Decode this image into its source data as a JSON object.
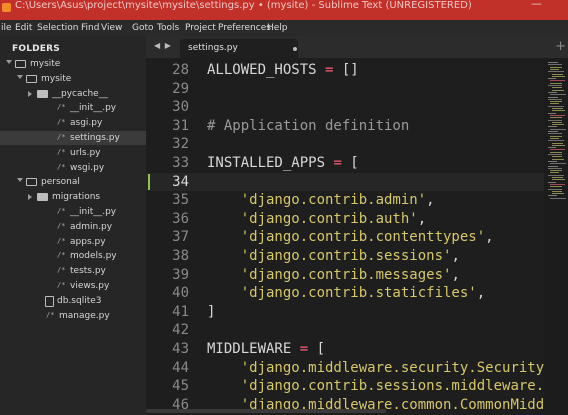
{
  "window": {
    "title": "C:\\Users\\Asus\\project\\mysite\\mysite\\settings.py • (mysite) - Sublime Text (UNREGISTERED)",
    "minimize_glyph": "—"
  },
  "menu": [
    "ile",
    "Edit",
    "Selection",
    "Find",
    "View",
    "Goto",
    "Tools",
    "Project",
    "Preferences",
    "Help"
  ],
  "sidebar": {
    "heading": "FOLDERS",
    "items": [
      {
        "label": "mysite",
        "kind": "folder-open"
      },
      {
        "label": "mysite",
        "kind": "folder-open"
      },
      {
        "label": "__pycache__",
        "kind": "folder-closed"
      },
      {
        "label": "__init__.py",
        "kind": "file"
      },
      {
        "label": "asgi.py",
        "kind": "file"
      },
      {
        "label": "settings.py",
        "kind": "file",
        "selected": true
      },
      {
        "label": "urls.py",
        "kind": "file"
      },
      {
        "label": "wsgi.py",
        "kind": "file"
      },
      {
        "label": "personal",
        "kind": "folder-open"
      },
      {
        "label": "migrations",
        "kind": "folder-closed"
      },
      {
        "label": "__init__.py",
        "kind": "file"
      },
      {
        "label": "admin.py",
        "kind": "file"
      },
      {
        "label": "apps.py",
        "kind": "file"
      },
      {
        "label": "models.py",
        "kind": "file"
      },
      {
        "label": "tests.py",
        "kind": "file"
      },
      {
        "label": "views.py",
        "kind": "file"
      },
      {
        "label": "db.sqlite3",
        "kind": "doc"
      },
      {
        "label": "manage.py",
        "kind": "file"
      }
    ],
    "file_glyph": "/*"
  },
  "tabbar": {
    "nav": "◀ ▶",
    "active_tab": "settings.py",
    "new_tab": "+"
  },
  "editor": {
    "active_line": 34,
    "lines": [
      {
        "n": 28,
        "tokens": [
          [
            "plain",
            "ALLOWED_HOSTS "
          ],
          [
            "op",
            "="
          ],
          [
            "plain",
            " []"
          ]
        ]
      },
      {
        "n": 29,
        "tokens": []
      },
      {
        "n": 30,
        "tokens": []
      },
      {
        "n": 31,
        "tokens": [
          [
            "comment",
            "# Application definition"
          ]
        ]
      },
      {
        "n": 32,
        "tokens": []
      },
      {
        "n": 33,
        "tokens": [
          [
            "plain",
            "INSTALLED_APPS "
          ],
          [
            "op",
            "="
          ],
          [
            "plain",
            " ["
          ]
        ]
      },
      {
        "n": 34,
        "tokens": []
      },
      {
        "n": 35,
        "tokens": [
          [
            "plain",
            "    "
          ],
          [
            "str",
            "'django.contrib.admin'"
          ],
          [
            "plain",
            ","
          ]
        ]
      },
      {
        "n": 36,
        "tokens": [
          [
            "plain",
            "    "
          ],
          [
            "str",
            "'django.contrib.auth'"
          ],
          [
            "plain",
            ","
          ]
        ]
      },
      {
        "n": 37,
        "tokens": [
          [
            "plain",
            "    "
          ],
          [
            "str",
            "'django.contrib.contenttypes'"
          ],
          [
            "plain",
            ","
          ]
        ]
      },
      {
        "n": 38,
        "tokens": [
          [
            "plain",
            "    "
          ],
          [
            "str",
            "'django.contrib.sessions'"
          ],
          [
            "plain",
            ","
          ]
        ]
      },
      {
        "n": 39,
        "tokens": [
          [
            "plain",
            "    "
          ],
          [
            "str",
            "'django.contrib.messages'"
          ],
          [
            "plain",
            ","
          ]
        ]
      },
      {
        "n": 40,
        "tokens": [
          [
            "plain",
            "    "
          ],
          [
            "str",
            "'django.contrib.staticfiles'"
          ],
          [
            "plain",
            ","
          ]
        ]
      },
      {
        "n": 41,
        "tokens": [
          [
            "plain",
            "]"
          ]
        ]
      },
      {
        "n": 42,
        "tokens": []
      },
      {
        "n": 43,
        "tokens": [
          [
            "plain",
            "MIDDLEWARE "
          ],
          [
            "op",
            "="
          ],
          [
            "plain",
            " ["
          ]
        ]
      },
      {
        "n": 44,
        "tokens": [
          [
            "plain",
            "    "
          ],
          [
            "str",
            "'django.middleware.security.Security"
          ]
        ]
      },
      {
        "n": 45,
        "tokens": [
          [
            "plain",
            "    "
          ],
          [
            "str",
            "'django.contrib.sessions.middleware."
          ]
        ]
      },
      {
        "n": 46,
        "tokens": [
          [
            "plain",
            "    "
          ],
          [
            "str",
            "'django.middleware.common.CommonMidd"
          ]
        ]
      }
    ]
  },
  "colors": {
    "titlebar": "#c2302a",
    "string": "#d6c76b",
    "operator": "#ff5f79",
    "comment": "#9a9a9a",
    "caret_marker": "#8fc24a"
  }
}
